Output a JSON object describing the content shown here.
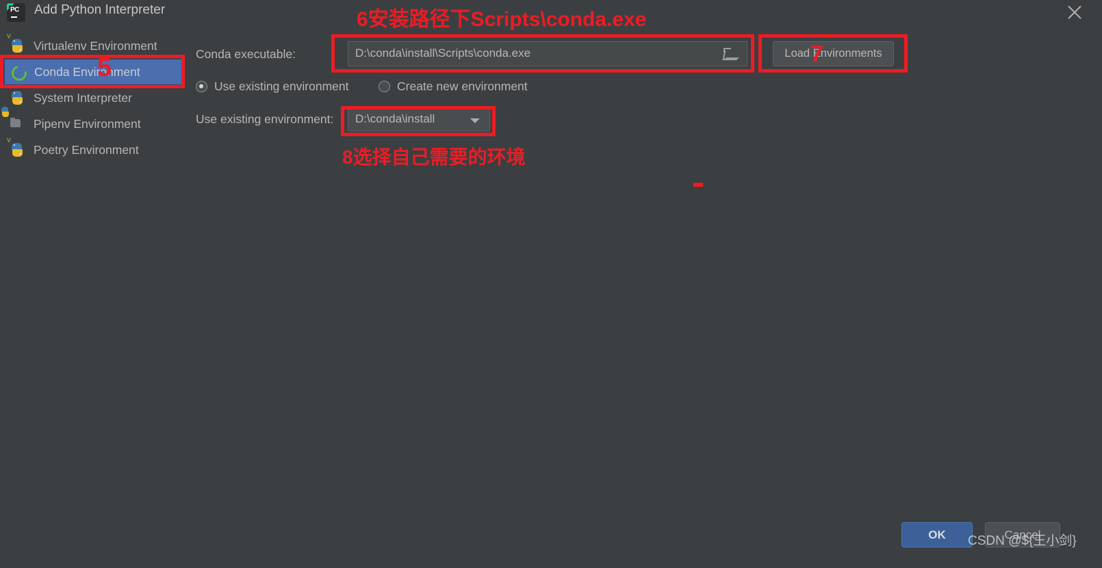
{
  "window": {
    "title": "Add Python Interpreter",
    "logo_icon": "pycharm-icon",
    "close_icon": "close-icon"
  },
  "sidebar": {
    "items": [
      {
        "label": "Virtualenv Environment",
        "icon": "python-virtualenv-icon",
        "selected": false
      },
      {
        "label": "Conda Environment",
        "icon": "conda-icon",
        "selected": true
      },
      {
        "label": "System Interpreter",
        "icon": "python-icon",
        "selected": false
      },
      {
        "label": "Pipenv Environment",
        "icon": "pipenv-folder-icon",
        "selected": false
      },
      {
        "label": "Poetry Environment",
        "icon": "python-poetry-icon",
        "selected": false
      }
    ]
  },
  "form": {
    "conda_executable_label": "Conda executable:",
    "conda_executable_value": "D:\\conda\\install\\Scripts\\conda.exe",
    "conda_executable_browse_icon": "folder-browse-icon",
    "load_environments_label": "Load Environments",
    "radio_use_existing_label": "Use existing environment",
    "radio_create_new_label": "Create new environment",
    "radio_selected": "use_existing",
    "existing_env_label": "Use existing environment:",
    "existing_env_value": "D:\\conda\\install",
    "existing_env_arrow_icon": "chevron-down-icon"
  },
  "footer": {
    "ok_label": "OK",
    "cancel_label": "Cancel"
  },
  "annotations": {
    "step6_text": "6安装路径下Scripts\\conda.exe",
    "step8_text": "8选择自己需要的环境",
    "step5_number": "5",
    "step7_number": "7"
  },
  "watermark": {
    "text": "CSDN @${王小剑}"
  },
  "colors": {
    "background": "#3c3f41",
    "selection": "#4b6eaf",
    "annotation_red": "#ed1c24",
    "ok_button": "#3c6097",
    "conda_green": "#5fbd3a"
  }
}
